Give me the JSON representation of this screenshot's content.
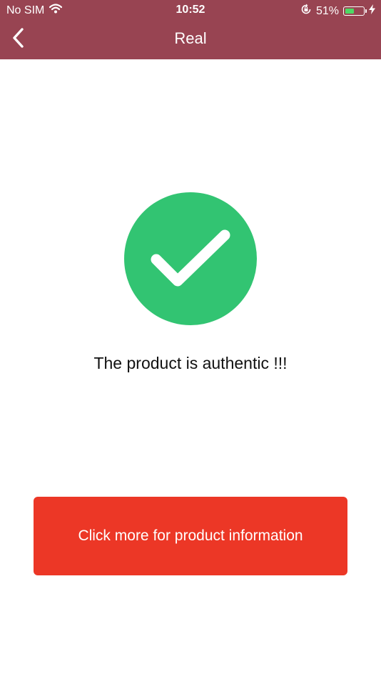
{
  "status_bar": {
    "carrier": "No SIM",
    "time": "10:52",
    "battery_percent_label": "51%",
    "battery_level": 0.51,
    "icons": [
      "wifi-icon",
      "rotation-lock-icon",
      "battery-icon",
      "charging-bolt-icon"
    ]
  },
  "nav": {
    "title": "Real",
    "back_icon": "chevron-left-icon"
  },
  "result": {
    "icon": "checkmark-icon",
    "message": "The product is authentic !!!"
  },
  "actions": {
    "more_info_label": "Click more for product information"
  },
  "colors": {
    "header_bg": "#984452",
    "success_green": "#32c472",
    "button_red": "#ec3726",
    "battery_green": "#4cd964"
  }
}
